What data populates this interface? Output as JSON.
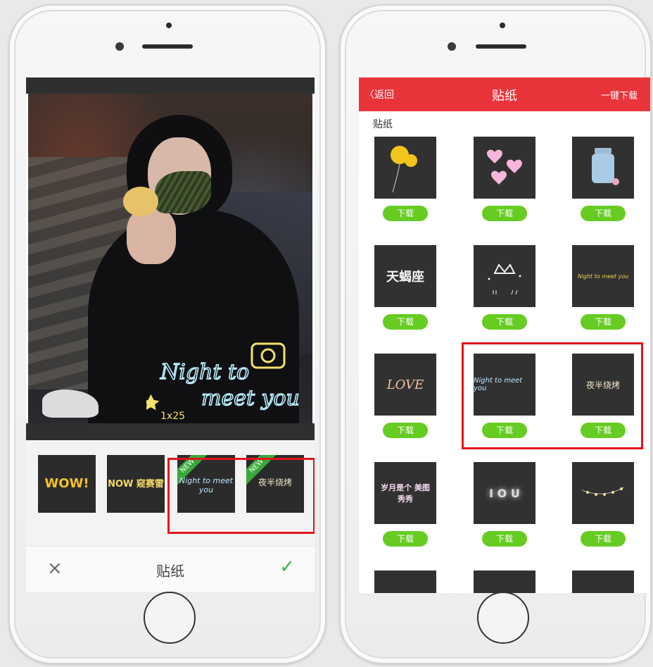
{
  "left_phone": {
    "bottom_bar": {
      "close_icon": "×",
      "title": "贴纸",
      "confirm_icon": "✓"
    },
    "photo_sticker_text": [
      "Night to",
      "meet you",
      "1x25"
    ],
    "sticker_strip": [
      {
        "label": "WOW!",
        "new": false
      },
      {
        "label": "NOW 窥赛雷",
        "new": false
      },
      {
        "label": "Night to meet you",
        "new": true,
        "badge": "NEW"
      },
      {
        "label": "夜半烧烤",
        "new": true,
        "badge": "NEW"
      }
    ]
  },
  "right_phone": {
    "nav": {
      "back": "〈返回",
      "title": "贴纸",
      "action": "一键下载"
    },
    "section_title": "贴纸",
    "download_label": "下载",
    "stickers": [
      {
        "name": "balloon"
      },
      {
        "name": "hearts"
      },
      {
        "name": "jar"
      },
      {
        "name": "天蝎座"
      },
      {
        "name": "crown"
      },
      {
        "name": "Night to meet you"
      },
      {
        "name": "LOVE"
      },
      {
        "name": "Night to meet you"
      },
      {
        "name": "夜半烧烤"
      },
      {
        "name": "岁月是个 美图秀秀"
      },
      {
        "name": "I O U"
      },
      {
        "name": "string lights"
      }
    ]
  },
  "colors": {
    "accent_red": "#e8343a",
    "download_green": "#66cc22",
    "highlight_red": "#e2141b",
    "confirm_green": "#36b34a"
  }
}
